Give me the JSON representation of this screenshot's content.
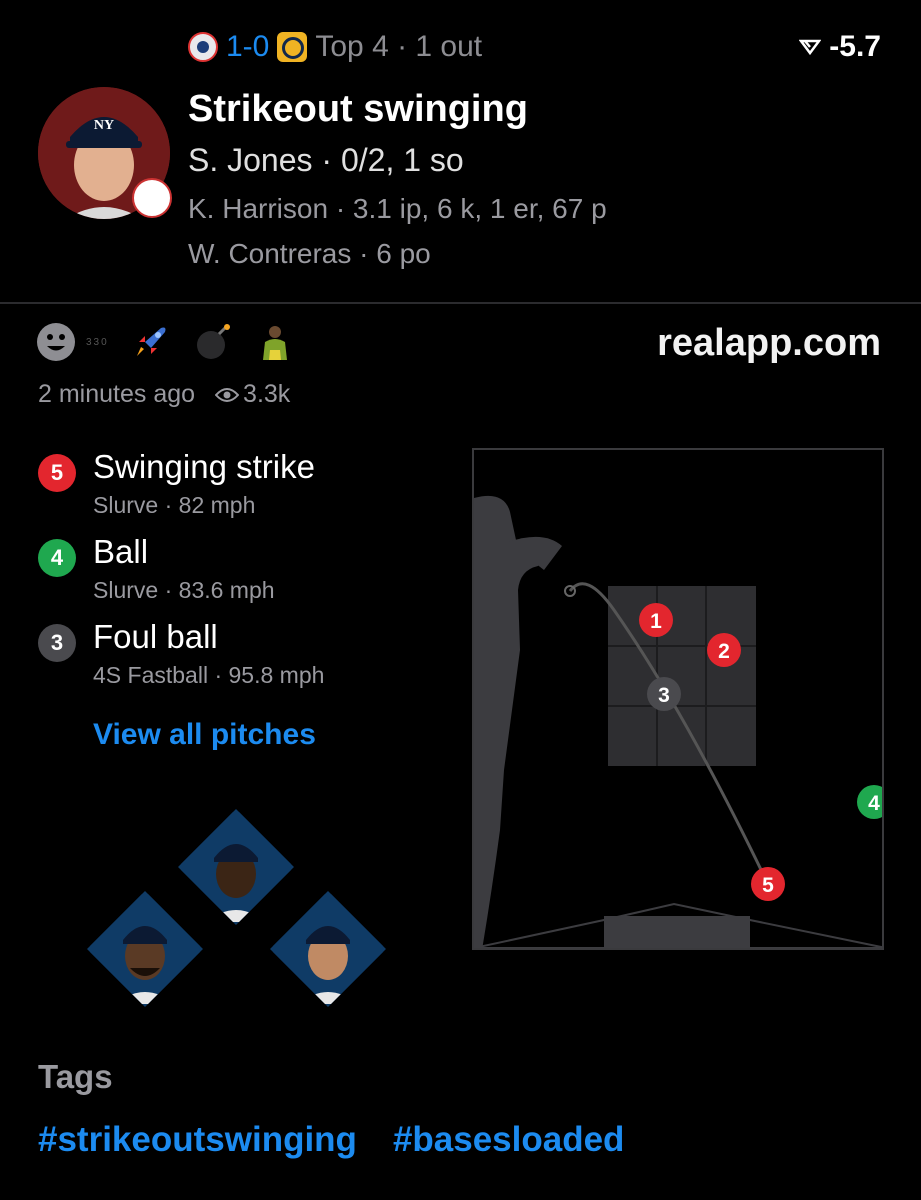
{
  "header": {
    "away_logo": "nyy-logo-icon",
    "score": "1-0",
    "home_logo": "mil-logo-icon",
    "inning": "Top 4 · 1 out",
    "win_prob_icon": "trend-icon",
    "win_prob": "-5.7"
  },
  "play": {
    "title": "Strikeout swinging",
    "batter": "S. Jones · 0/2, 1 so",
    "pitcher": "K. Harrison · 3.1 ip, 6 k, 1 er, 67 p",
    "catcher": "W. Contreras · 6 po"
  },
  "social": {
    "reactions": [
      "smiley-face-icon",
      "rocket-icon",
      "bomb-icon",
      "player-icon"
    ],
    "reaction_count": "330",
    "site": "realapp.com",
    "time_ago": "2 minutes ago",
    "views": "3.3k"
  },
  "pitches": [
    {
      "num": "5",
      "result": "Swinging strike",
      "type": "Slurve",
      "speed": "82 mph",
      "color": "#e3262e"
    },
    {
      "num": "4",
      "result": "Ball",
      "type": "Slurve",
      "speed": "83.6 mph",
      "color": "#1fa84f"
    },
    {
      "num": "3",
      "result": "Foul ball",
      "type": "4S Fastball",
      "speed": "95.8 mph",
      "color": "#4a4a4e"
    }
  ],
  "view_all_label": "View all pitches",
  "zone_pitches": [
    {
      "num": "1",
      "color": "#e3262e"
    },
    {
      "num": "2",
      "color": "#e3262e"
    },
    {
      "num": "3",
      "color": "#4a4a4e"
    },
    {
      "num": "4",
      "color": "#1fa84f"
    },
    {
      "num": "5",
      "color": "#e3262e"
    }
  ],
  "tags": {
    "title": "Tags",
    "items": [
      "#strikeoutswinging",
      "#basesloaded"
    ]
  }
}
